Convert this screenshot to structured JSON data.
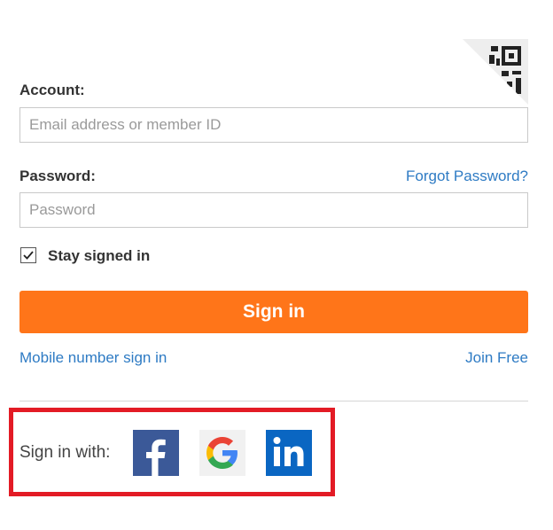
{
  "form": {
    "account_label": "Account:",
    "account_placeholder": "Email address or member ID",
    "password_label": "Password:",
    "password_placeholder": "Password",
    "forgot_password": "Forgot Password?",
    "stay_signed_in": "Stay signed in",
    "stay_signed_in_checked": true,
    "sign_in_button": "Sign in",
    "mobile_sign_in": "Mobile number sign in",
    "join_free": "Join Free"
  },
  "social": {
    "label": "Sign in with:",
    "providers": [
      "facebook-icon",
      "google-icon",
      "linkedin-icon"
    ]
  },
  "colors": {
    "accent": "#ff7519",
    "link": "#2e7bc4",
    "highlight": "#e31b25",
    "facebook": "#3b5998",
    "linkedin": "#0a66c2"
  },
  "icons": {
    "qr_corner": "qr-code-icon"
  }
}
